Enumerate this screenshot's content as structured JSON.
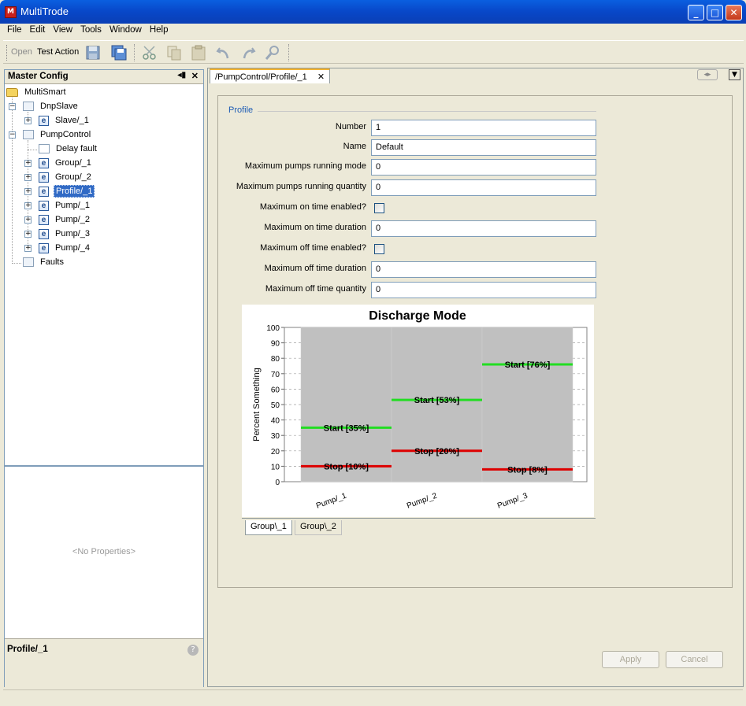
{
  "window": {
    "title": "MultiTrode",
    "app_icon_text": "M",
    "minimize": "_",
    "maximize": "□",
    "close": "✕"
  },
  "menu": [
    "File",
    "Edit",
    "View",
    "Tools",
    "Window",
    "Help"
  ],
  "toolbar": {
    "open_label": "Open",
    "test_action_label": "Test Action",
    "icons": [
      "save-icon",
      "save-all-icon",
      "cut-icon",
      "copy-icon",
      "paste-icon",
      "undo-icon",
      "redo-icon",
      "find-icon"
    ]
  },
  "explorer": {
    "title": "Master Config",
    "tree": [
      {
        "label": "MultiSmart",
        "icon": "folder-open-icon"
      },
      {
        "label": "DnpSlave",
        "icon": "module-icon"
      },
      {
        "label": "Slave/_1",
        "icon": "element-icon"
      },
      {
        "label": "PumpControl",
        "icon": "module-icon"
      },
      {
        "label": "Delay fault",
        "icon": "fault-icon"
      },
      {
        "label": "Group/_1",
        "icon": "element-icon"
      },
      {
        "label": "Group/_2",
        "icon": "element-icon"
      },
      {
        "label": "Profile/_1",
        "icon": "element-icon",
        "selected": true
      },
      {
        "label": "Pump/_1",
        "icon": "element-icon"
      },
      {
        "label": "Pump/_2",
        "icon": "element-icon"
      },
      {
        "label": "Pump/_3",
        "icon": "element-icon"
      },
      {
        "label": "Pump/_4",
        "icon": "element-icon"
      },
      {
        "label": "Faults",
        "icon": "module-icon"
      }
    ]
  },
  "properties": {
    "empty_text": "<No Properties>",
    "footer_title": "Profile/_1"
  },
  "editor": {
    "tab_label": "/PumpControl/Profile/_1",
    "section_title": "Profile",
    "fields": [
      {
        "label": "Number",
        "type": "text",
        "value": "1"
      },
      {
        "label": "Name",
        "type": "text",
        "value": "Default"
      },
      {
        "label": "Maximum pumps running mode",
        "type": "text",
        "value": "0"
      },
      {
        "label": "Maximum pumps running quantity",
        "type": "text",
        "value": "0"
      },
      {
        "label": "Maximum on time enabled?",
        "type": "checkbox",
        "checked": false
      },
      {
        "label": "Maximum on time duration",
        "type": "text",
        "value": "0"
      },
      {
        "label": "Maximum off time enabled?",
        "type": "checkbox",
        "checked": false
      },
      {
        "label": "Maximum off time duration",
        "type": "text",
        "value": "0"
      },
      {
        "label": "Maximum off time quantity",
        "type": "text",
        "value": "0"
      }
    ],
    "chart_tabs": [
      "Group\\_1",
      "Group\\_2"
    ],
    "apply_label": "Apply",
    "cancel_label": "Cancel"
  },
  "chart_data": {
    "type": "bar",
    "title": "Discharge Mode",
    "ylabel": "Percent Something",
    "xlabel": "",
    "ylim": [
      0,
      100
    ],
    "yticks": [
      0,
      10,
      20,
      30,
      40,
      50,
      60,
      70,
      80,
      90,
      100
    ],
    "categories": [
      "Pump/_1",
      "Pump/_2",
      "Pump/_3"
    ],
    "series": [
      {
        "values": [
          100,
          100,
          100
        ],
        "color": "#c0c0c0"
      },
      {
        "values": [
          35,
          53,
          76
        ],
        "color": "#22dd22",
        "labels": [
          "Start [35%]",
          "Start [53%]",
          "Start [76%]"
        ]
      },
      {
        "values": [
          10,
          20,
          8
        ],
        "color": "#dd0000",
        "labels": [
          "Stop [10%]",
          "Stop [20%]",
          "Stop [8%]"
        ]
      }
    ],
    "grid": true,
    "background": "#ffffff"
  }
}
